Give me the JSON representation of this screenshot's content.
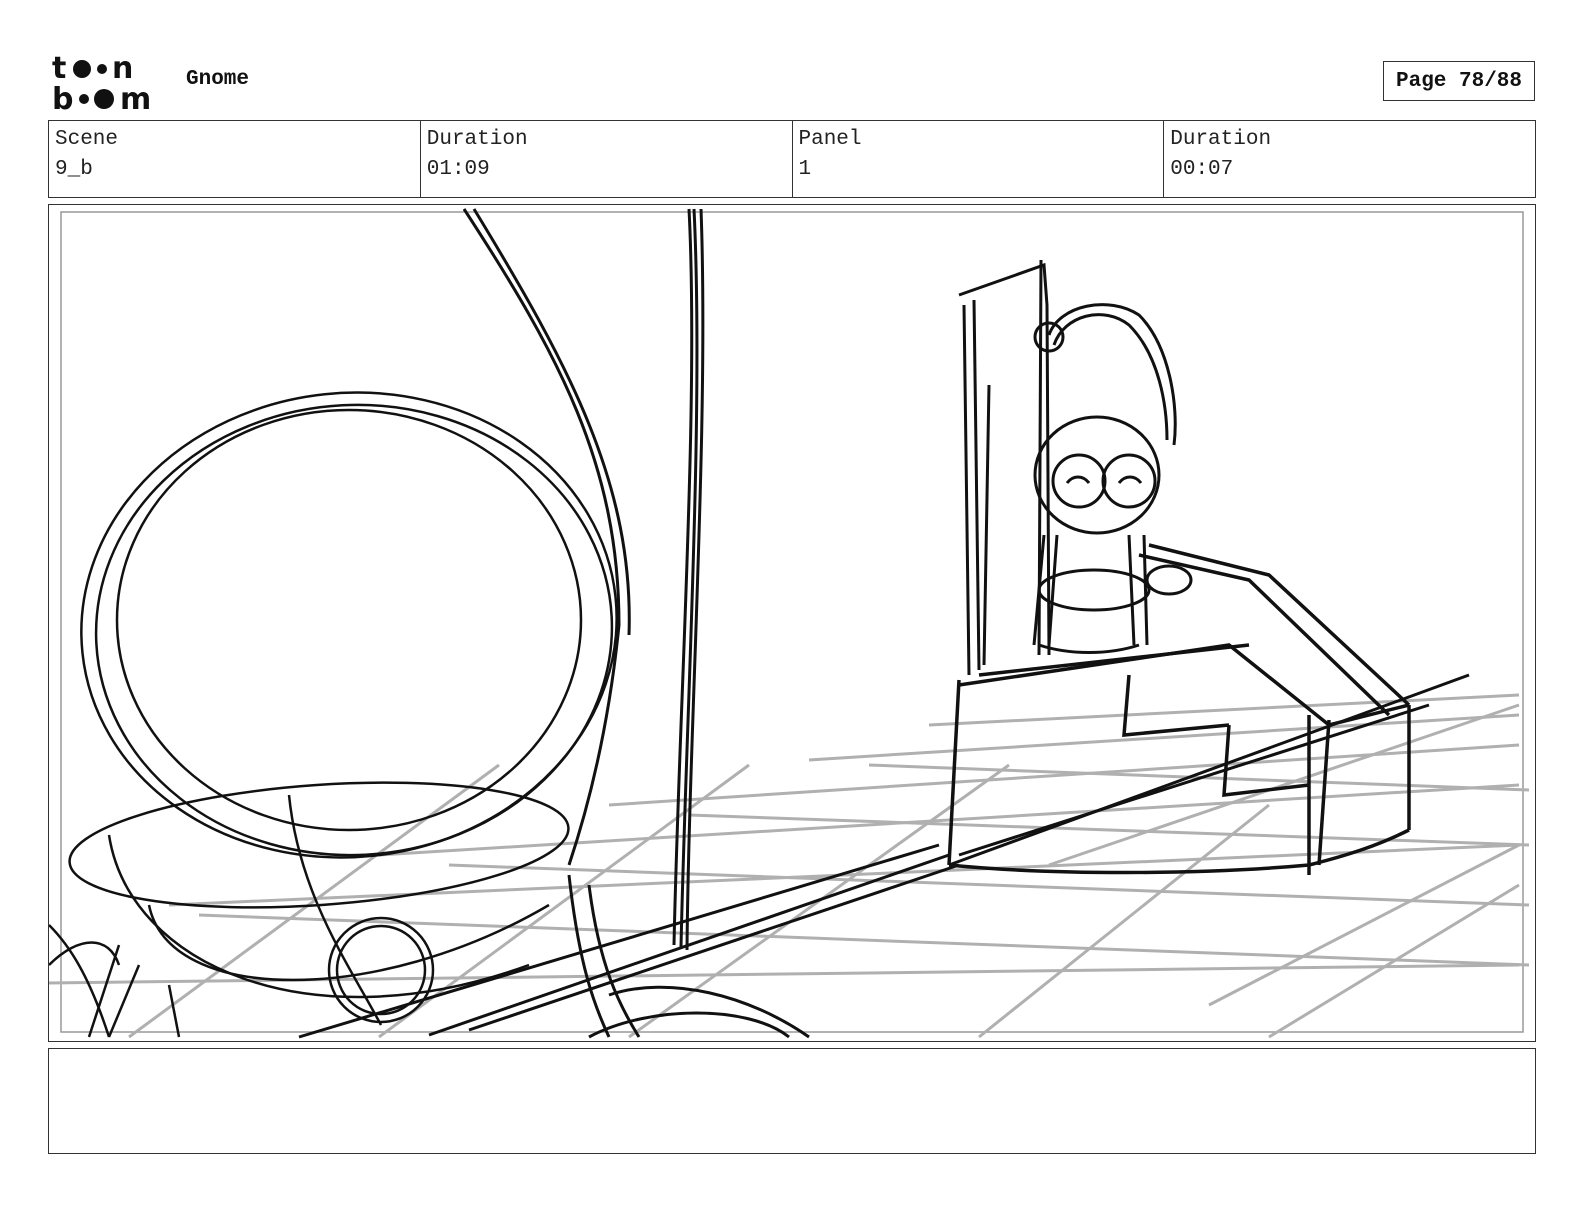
{
  "header": {
    "logo_alt": "toon boom",
    "project_title": "Gnome",
    "page_label": "Page 78/88"
  },
  "info": {
    "scene_label": "Scene",
    "scene_value": "9_b",
    "scene_duration_label": "Duration",
    "scene_duration_value": "01:09",
    "panel_label": "Panel",
    "panel_value": "1",
    "panel_duration_label": "Duration",
    "panel_duration_value": "00:07"
  },
  "notes": {
    "text": ""
  },
  "colors": {
    "ink": "#111111",
    "floor_grid": "#b0b0b0",
    "border": "#333333"
  }
}
